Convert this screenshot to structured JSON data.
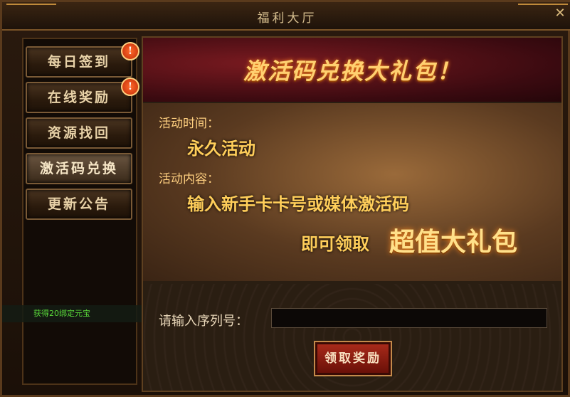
{
  "window": {
    "title": "福利大厅",
    "close_label": "✕"
  },
  "sidebar": {
    "items": [
      {
        "label": "每日签到",
        "alert": "!"
      },
      {
        "label": "在线奖励",
        "alert": "!"
      },
      {
        "label": "资源找回"
      },
      {
        "label": "激活码兑换"
      },
      {
        "label": "更新公告"
      }
    ]
  },
  "notification": {
    "text": "获得20绑定元宝"
  },
  "panel": {
    "banner_title": "激活码兑换大礼包！",
    "time_label": "活动时间：",
    "time_value": "永久活动",
    "content_label": "活动内容：",
    "content_line1": "输入新手卡卡号或媒体激活码",
    "content_line2_prefix": "即可领取",
    "content_line2_highlight": "超值大礼包",
    "serial_label": "请输入序列号：",
    "serial_value": "",
    "claim_button": "领取奖励"
  }
}
